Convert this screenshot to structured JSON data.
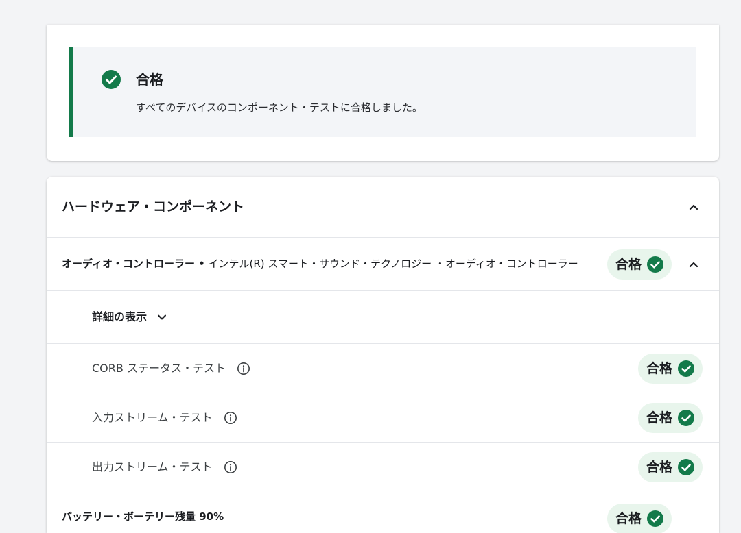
{
  "summary": {
    "status_title": "合格",
    "status_description": "すべてのデバイスのコンポーネント・テストに合格しました。",
    "icon": "check-circle-icon",
    "accent_color": "#137a4a"
  },
  "hardware": {
    "section_title": "ハードウェア・コンポーネント",
    "controller": {
      "name": "オーディオ・コントローラー •",
      "device": " インテル(R) スマート・サウンド・テクノロジー ・オーディオ・コントローラー",
      "status": "合格"
    },
    "details_toggle_label": "詳細の表示",
    "tests": [
      {
        "label": "CORB ステータス・テスト",
        "status": "合格"
      },
      {
        "label": "入力ストリーム・テスト",
        "status": "合格"
      },
      {
        "label": "出力ストリーム・テスト",
        "status": "合格"
      }
    ],
    "next_component": {
      "text": "バッテリー・ボーテリー残量 90%",
      "status": "合格"
    }
  },
  "colors": {
    "pass_green": "#137a4a",
    "pill_background": "#e8f5ec"
  }
}
